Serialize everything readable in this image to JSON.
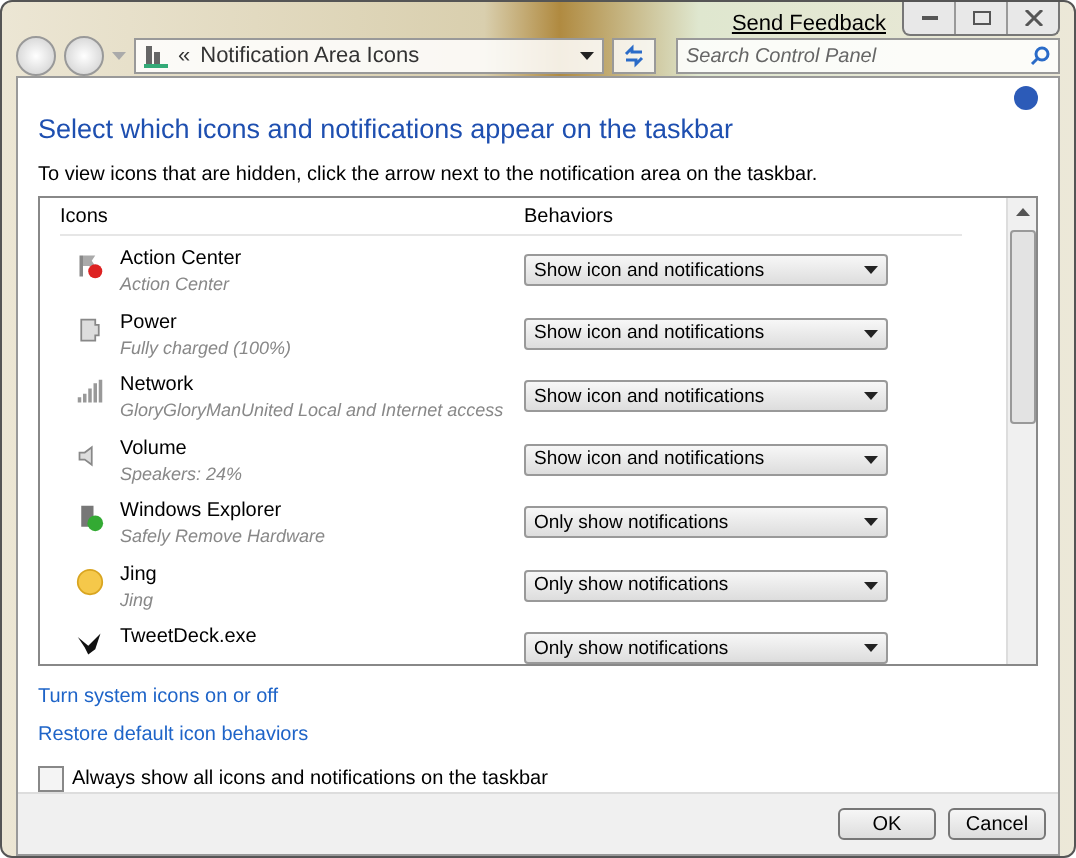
{
  "window": {
    "send_feedback": "Send Feedback"
  },
  "address_bar": {
    "chevron": "«",
    "path": "Notification Area Icons"
  },
  "search": {
    "placeholder": "Search Control Panel"
  },
  "heading": "Select which icons and notifications appear on the taskbar",
  "instructions": "To view icons that are hidden, click the arrow next to the notification area on the taskbar.",
  "table": {
    "columns": [
      "Icons",
      "Behaviors"
    ],
    "rows": [
      {
        "kind": "flag",
        "name": "Action Center",
        "detail": "Action Center",
        "behavior": "Show icon and notifications"
      },
      {
        "kind": "power",
        "name": "Power",
        "detail": "Fully charged (100%)",
        "behavior": "Show icon and notifications"
      },
      {
        "kind": "signal",
        "name": "Network",
        "detail": "GloryGloryManUnited Local and Internet access",
        "behavior": "Show icon and notifications"
      },
      {
        "kind": "speaker",
        "name": "Volume",
        "detail": "Speakers: 24%",
        "behavior": "Show icon and notifications"
      },
      {
        "kind": "drive",
        "name": "Windows Explorer",
        "detail": "Safely Remove Hardware",
        "behavior": "Only show notifications"
      },
      {
        "kind": "sun",
        "name": "Jing",
        "detail": "Jing",
        "behavior": "Only show notifications"
      },
      {
        "kind": "bird",
        "name": "TweetDeck.exe",
        "behavior": "Only show notifications"
      }
    ]
  },
  "links": [
    "Turn system icons on or off",
    "Restore default icon behaviors"
  ],
  "always_show": {
    "label": "Always show all icons and notifications on the taskbar",
    "checked": false
  },
  "buttons": [
    "OK",
    "Cancel"
  ]
}
